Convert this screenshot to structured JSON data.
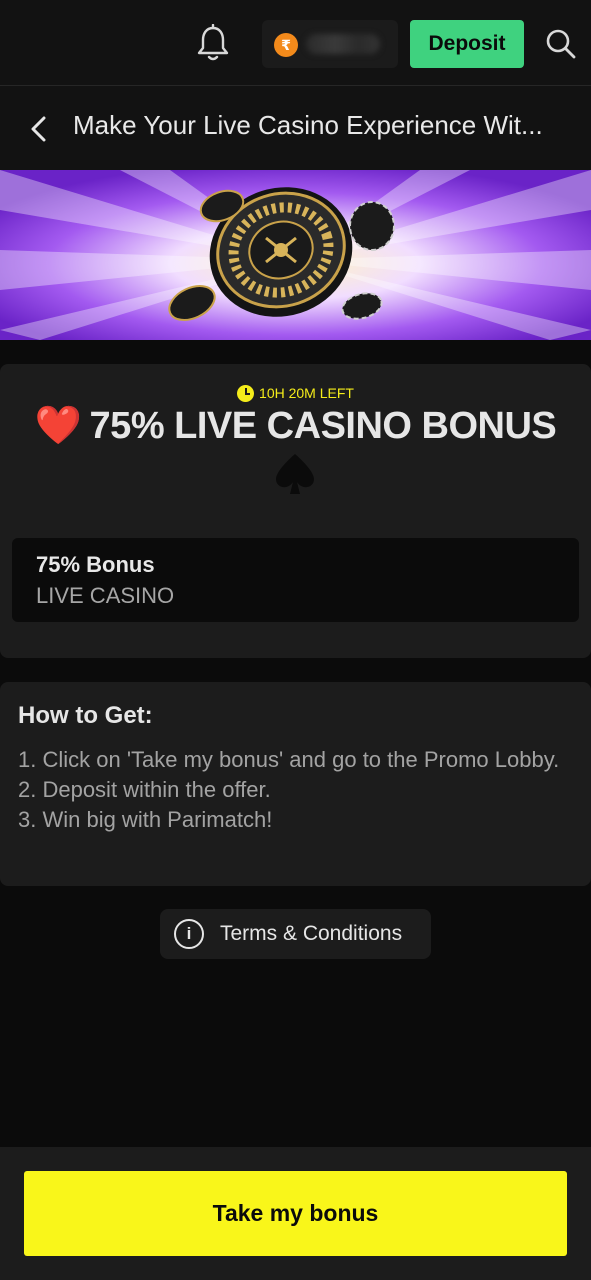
{
  "header": {
    "currency_symbol": "₹",
    "deposit_label": "Deposit",
    "icons": [
      "bell-icon",
      "rupee-coin-icon",
      "search-icon"
    ]
  },
  "titlebar": {
    "title": "Make Your Live Casino Experience Wit...",
    "back_icon": "chevron-left-icon"
  },
  "banner": {
    "image": "roulette-wheel-with-chips",
    "colors": {
      "rays_dark": "#6a23c7",
      "rays_light": "#f3e6ff",
      "center_glow": "#fff5c4"
    }
  },
  "offer": {
    "timer": "10H 20M LEFT",
    "title_emoji": "❤️",
    "title": "75% LIVE CASINO BONUS",
    "suit_icon": "spade-icon",
    "bonus_amount": "75% Bonus",
    "bonus_category": "LIVE CASINO"
  },
  "howto": {
    "title": "How to Get:",
    "steps": [
      "1. Click on 'Take my bonus' and go to the Promo Lobby.",
      "2. Deposit within the offer.",
      "3. Win big with Parimatch!"
    ]
  },
  "terms": {
    "label": "Terms & Conditions",
    "icon": "info-icon"
  },
  "cta": {
    "label": "Take my bonus"
  },
  "colors": {
    "deposit_green": "#3fd27f",
    "cta_yellow": "#f9f61a",
    "timer_yellow": "#f4ec1a",
    "background": "#0b0b0b",
    "card": "#1c1c1c"
  }
}
